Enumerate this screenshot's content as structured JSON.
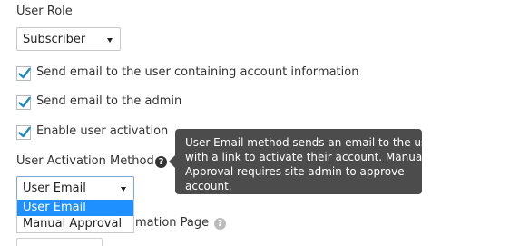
{
  "user_role": {
    "label": "User Role",
    "select_value": "Subscriber"
  },
  "checkboxes": [
    {
      "label": "Send email to the user containing account information",
      "checked": true
    },
    {
      "label": "Send email to the admin",
      "checked": true
    },
    {
      "label": "Enable user activation",
      "checked": true
    }
  ],
  "activation": {
    "label": "User Activation Method",
    "help_glyph": "?",
    "tooltip_lines": [
      "User Email method sends an email to the user",
      "with a link to activate their account. Manual",
      "Approval requires site admin to approve",
      "account."
    ],
    "select_value": "User Email",
    "options": [
      "User Email",
      "Manual Approval"
    ],
    "highlighted_option": "User Email"
  },
  "confirmation_page": {
    "label_visible_part": "mation Page",
    "help_glyph": "?"
  },
  "colors": {
    "checkmark": "#1e8cbe",
    "option_highlight": "#1e90ff",
    "tooltip_bg": "#4c4c4c",
    "help_icon_dark": "#333333",
    "help_icon_light": "#bbbbbb"
  },
  "icons": {
    "activation_help": "question-circle-icon",
    "confirmation_help": "question-circle-icon",
    "select_caret": "caret-down-icon",
    "checkbox": "checkmark-icon"
  }
}
